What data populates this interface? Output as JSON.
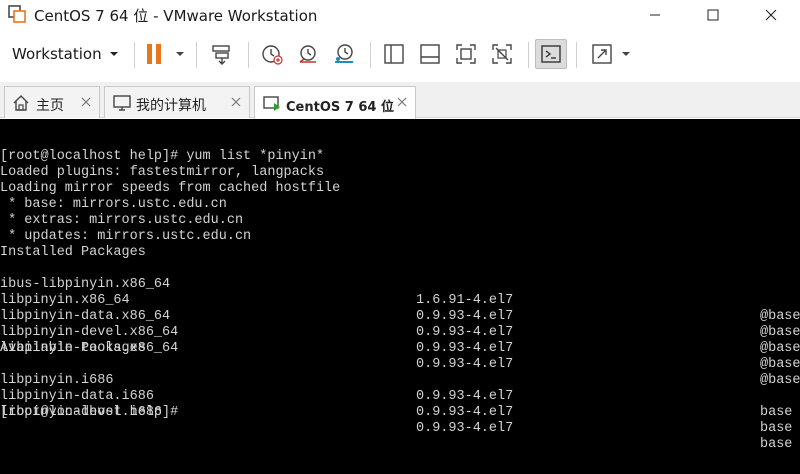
{
  "window": {
    "title": "CentOS 7 64 位 - VMware Workstation",
    "controls": [
      "minimize-icon",
      "maximize-icon",
      "close-icon"
    ]
  },
  "toolbar": {
    "menu_label": "Workstation",
    "icons": [
      "pause-icon",
      "dropdown-arrow-icon",
      "send-ctrl-alt-del-icon",
      "snapshot-icon",
      "revert-snapshot-icon",
      "snapshot-manager-icon",
      "library-view-icon",
      "thumbnail-view-icon",
      "fit-guest-icon",
      "unity-icon",
      "console-view-icon",
      "fullscreen-icon",
      "dropdown-arrow-icon"
    ],
    "accent_color": "#e8761e"
  },
  "tabs": [
    {
      "label": "主页",
      "icon": "home-icon",
      "active": false
    },
    {
      "label": "我的计算机",
      "icon": "computer-icon",
      "active": false
    },
    {
      "label": "CentOS 7 64 位",
      "icon": "vm-running-icon",
      "active": true
    }
  ],
  "console": {
    "lines": [
      {
        "text": "[root@localhost help]# yum list *pinyin*"
      },
      {
        "text": "Loaded plugins: fastestmirror, langpacks"
      },
      {
        "text": "Loading mirror speeds from cached hostfile"
      },
      {
        "text": " * base: mirrors.ustc.edu.cn"
      },
      {
        "text": " * extras: mirrors.ustc.edu.cn"
      },
      {
        "text": " * updates: mirrors.ustc.edu.cn"
      },
      {
        "text": "Installed Packages"
      },
      {
        "name": "ibus-libpinyin.x86_64",
        "version": "1.6.91-4.el7",
        "repo": "@base"
      },
      {
        "name": "libpinyin.x86_64",
        "version": "0.9.93-4.el7",
        "repo": "@base"
      },
      {
        "name": "libpinyin-data.x86_64",
        "version": "0.9.93-4.el7",
        "repo": "@base"
      },
      {
        "name": "libpinyin-devel.x86_64",
        "version": "0.9.93-4.el7",
        "repo": "@base"
      },
      {
        "name": "libpinyin-tools.x86_64",
        "version": "0.9.93-4.el7",
        "repo": "@base"
      },
      {
        "text": "Available Packages"
      },
      {
        "name": "libpinyin.i686",
        "version": "0.9.93-4.el7",
        "repo": "base"
      },
      {
        "name": "libpinyin-data.i686",
        "version": "0.9.93-4.el7",
        "repo": "base"
      },
      {
        "name": "libpinyin-devel.i686",
        "version": "0.9.93-4.el7",
        "repo": "base"
      },
      {
        "text": "[root@localhost help]#"
      }
    ]
  }
}
